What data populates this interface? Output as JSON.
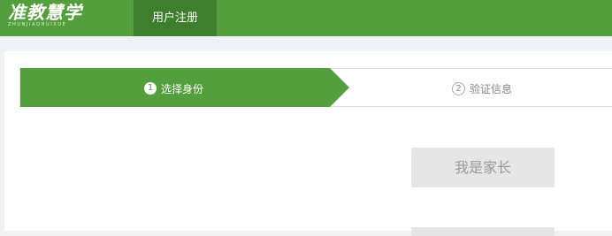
{
  "header": {
    "logo_text": "准教慧学",
    "logo_subtext": "ZHUNJIAOHUIXUE",
    "nav_tab_label": "用户注册"
  },
  "steps": [
    {
      "number": "1",
      "label": "选择身份",
      "active": true
    },
    {
      "number": "2",
      "label": "验证信息",
      "active": false
    }
  ],
  "roles": {
    "parent_label": "我是家长",
    "second_label": ""
  },
  "colors": {
    "brand_green": "#549f3d",
    "nav_active": "#3e7f2d",
    "button_gray": "#e6e6e6"
  }
}
